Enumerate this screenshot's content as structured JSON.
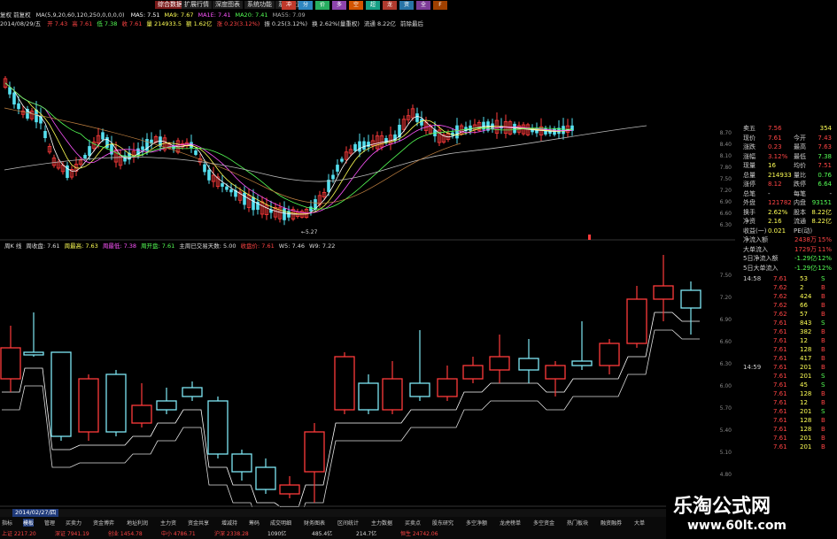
{
  "topbar": {
    "items": [
      {
        "label": "综合数据",
        "active": true
      },
      {
        "label": "扩展行情",
        "active": false
      },
      {
        "label": "深度图表",
        "active": false
      },
      {
        "label": "系统功能",
        "active": false
      },
      {
        "label": "系统设置",
        "active": false
      }
    ],
    "color_boxes": [
      {
        "label": "冲",
        "color": "#c0392b"
      },
      {
        "label": "分",
        "color": "#2e86c1"
      },
      {
        "label": "价",
        "color": "#27ae60"
      },
      {
        "label": "多",
        "color": "#8e44ad"
      },
      {
        "label": "空",
        "color": "#d35400"
      },
      {
        "label": "超",
        "color": "#16a085"
      },
      {
        "label": "龙",
        "color": "#b03a2e"
      },
      {
        "label": "资",
        "color": "#2874a6"
      },
      {
        "label": "全",
        "color": "#7d3c98"
      },
      {
        "label": "F",
        "color": "#a04000"
      }
    ]
  },
  "ma_line": {
    "name": "复权 前复权",
    "params": "MA(5,9,20,60,120,250,0,0,0,0)",
    "items": [
      {
        "label": "MA5: 7.51",
        "color": "#ffffff"
      },
      {
        "label": "MA9: 7.67",
        "color": "#ffff55"
      },
      {
        "label": "MA1E: 7.41",
        "color": "#ff55ff"
      },
      {
        "label": "MA20: 7.41",
        "color": "#55ff55"
      },
      {
        "label": "MA55: 7.09",
        "color": "#aaaaaa"
      }
    ]
  },
  "info_line": {
    "date": "2014/08/29/五",
    "items": [
      {
        "label": "开 7.43",
        "color": "#ff4444"
      },
      {
        "label": "高 7.61",
        "color": "#ff4444"
      },
      {
        "label": "低 7.38",
        "color": "#55ff55"
      },
      {
        "label": "收 7.61",
        "color": "#ff4444"
      },
      {
        "label": "量 214933.5",
        "color": "#ffff55"
      },
      {
        "label": "额 1.62亿",
        "color": "#ffff55"
      },
      {
        "label": "涨 0.23(3.12%)",
        "color": "#ff4444"
      },
      {
        "label": "振 0.25(3.12%)",
        "color": "#dddddd"
      },
      {
        "label": "换 2.62%(量重权)",
        "color": "#dddddd"
      },
      {
        "label": "流通 8.22亿",
        "color": "#dddddd"
      },
      {
        "label": "前除最后",
        "color": "#dddddd"
      }
    ]
  },
  "main_axis": {
    "labels": [
      "8.70",
      "8.40",
      "8.10",
      "7.80",
      "7.50",
      "7.20",
      "6.90",
      "6.60",
      "6.30"
    ]
  },
  "main_annotation": "←5.27",
  "lower_legend": {
    "items": [
      {
        "label": "周K 线",
        "color": "#dddddd"
      },
      {
        "label": "周收盘: 7.61",
        "color": "#dddddd"
      },
      {
        "label": "周最高: 7.63",
        "color": "#ffff55"
      },
      {
        "label": "周最低: 7.38",
        "color": "#ff55ff"
      },
      {
        "label": "周开盘: 7.61",
        "color": "#55ff55"
      },
      {
        "label": "主周已交易天数: 5.00",
        "color": "#dddddd"
      },
      {
        "label": "收盘价: 7.61",
        "color": "#ff4444"
      },
      {
        "label": "W5: 7.46",
        "color": "#dddddd"
      },
      {
        "label": "W9: 7.22",
        "color": "#dddddd"
      }
    ]
  },
  "lower_axis": {
    "labels": [
      "7.50",
      "7.20",
      "6.90",
      "6.60",
      "6.30",
      "6.00",
      "5.70",
      "5.40",
      "5.10",
      "4.80",
      "4.50"
    ]
  },
  "quote_panel": {
    "rows": [
      {
        "label": "卖五",
        "value": "7.56",
        "value_color": "#ff4444",
        "extra": "354",
        "extra_color": "#ffff55"
      },
      {
        "label": "现价",
        "value": "7.61",
        "value_color": "#ff4444",
        "label2": "今开",
        "value2": "7.43",
        "value2_color": "#ff4444"
      },
      {
        "label": "涨跌",
        "value": "0.23",
        "value_color": "#ff4444",
        "label2": "最高",
        "value2": "7.63",
        "value2_color": "#ff4444"
      },
      {
        "label": "涨幅",
        "value": "3.12%",
        "value_color": "#ff4444",
        "label2": "最低",
        "value2": "7.38",
        "value2_color": "#55ff55"
      },
      {
        "label": "现量",
        "value": "16",
        "value_color": "#ffff55",
        "label2": "均价",
        "value2": "7.51",
        "value2_color": "#ff4444"
      },
      {
        "label": "总量",
        "value": "214933",
        "value_color": "#ffff55",
        "label2": "量比",
        "value2": "0.76",
        "value2_color": "#55ff55"
      },
      {
        "label": "涨停",
        "value": "8.12",
        "value_color": "#ff4444",
        "label2": "跌停",
        "value2": "6.64",
        "value2_color": "#55ff55"
      },
      {
        "label": "总笔",
        "value": "-",
        "value_color": "#dddddd",
        "label2": "每笔",
        "value2": "-",
        "value2_color": "#dddddd"
      },
      {
        "label": "外盘",
        "value": "121782",
        "value_color": "#ff4444",
        "label2": "内盘",
        "value2": "93151",
        "value2_color": "#55ff55"
      },
      {
        "label": "换手",
        "value": "2.62%",
        "value_color": "#ffff55",
        "label2": "股本",
        "value2": "8.22亿",
        "value2_color": "#ffff55"
      },
      {
        "label": "净资",
        "value": "2.16",
        "value_color": "#ffff55",
        "label2": "流通",
        "value2": "8.22亿",
        "value2_color": "#ffff55"
      },
      {
        "label": "收益(一)",
        "value": "0.021",
        "value_color": "#ffff55",
        "label2": "PE(动)",
        "value2": "",
        "value2_color": "#ffff55"
      }
    ],
    "flow_rows": [
      {
        "label": "净流入额",
        "value": "2438万",
        "pct": "15%"
      },
      {
        "label": "大单流入",
        "value": "1729万",
        "pct": "11%"
      },
      {
        "label": "5日净流入额",
        "value": "-1.29亿",
        "pct": "-12%"
      },
      {
        "label": "5日大单流入",
        "value": "-1.29亿",
        "pct": "-12%"
      }
    ],
    "ticks": [
      {
        "time": "14:58",
        "price": "7.61",
        "vol": "53",
        "side": "S"
      },
      {
        "time": "",
        "price": "7.62",
        "vol": "2",
        "side": "B"
      },
      {
        "time": "",
        "price": "7.62",
        "vol": "424",
        "side": "B"
      },
      {
        "time": "",
        "price": "7.62",
        "vol": "66",
        "side": "B"
      },
      {
        "time": "",
        "price": "7.62",
        "vol": "57",
        "side": "B"
      },
      {
        "time": "",
        "price": "7.61",
        "vol": "843",
        "side": "S"
      },
      {
        "time": "",
        "price": "7.61",
        "vol": "382",
        "side": "B"
      },
      {
        "time": "",
        "price": "7.61",
        "vol": "12",
        "side": "B"
      },
      {
        "time": "",
        "price": "7.61",
        "vol": "128",
        "side": "B"
      },
      {
        "time": "",
        "price": "7.61",
        "vol": "417",
        "side": "B"
      },
      {
        "time": "14:59",
        "price": "7.61",
        "vol": "201",
        "side": "B"
      },
      {
        "time": "",
        "price": "7.61",
        "vol": "201",
        "side": "S"
      },
      {
        "time": "",
        "price": "7.61",
        "vol": "45",
        "side": "S"
      },
      {
        "time": "",
        "price": "7.61",
        "vol": "128",
        "side": "B"
      },
      {
        "time": "",
        "price": "7.61",
        "vol": "12",
        "side": "B"
      },
      {
        "time": "",
        "price": "7.61",
        "vol": "201",
        "side": "S"
      },
      {
        "time": "",
        "price": "7.61",
        "vol": "128",
        "side": "B"
      },
      {
        "time": "",
        "price": "7.61",
        "vol": "128",
        "side": "B"
      },
      {
        "time": "",
        "price": "7.61",
        "vol": "201",
        "side": "B"
      },
      {
        "time": "",
        "price": "7.61",
        "vol": "201",
        "side": "B"
      }
    ]
  },
  "bottom": {
    "date_tab": "2014/02/27/四",
    "nav": [
      "指标",
      "模板",
      "管理",
      "买卖力",
      "资金博弈",
      "地址利润",
      "主力资",
      "资金共享",
      "增减持",
      "筹码",
      "成交明细",
      "财务图表",
      "区间统计",
      "主力数据",
      "买卖点",
      "股东研究",
      "多空净额",
      "龙虎榜单",
      "多空资金",
      "热门板块",
      "融资融券",
      "大单"
    ],
    "ticker": [
      {
        "label": "上证 2217.20",
        "color": "#ff4444"
      },
      {
        "label": "深证 7941.19",
        "color": "#ff4444"
      },
      {
        "label": "创业 1454.78",
        "color": "#ff4444"
      },
      {
        "label": "中小 4786.71",
        "color": "#ff4444"
      },
      {
        "label": "沪深 2338.28",
        "color": "#ff4444"
      },
      {
        "label": "1090亿",
        "color": "#dddddd"
      },
      {
        "label": "485.4亿",
        "color": "#dddddd"
      },
      {
        "label": "214.7亿",
        "color": "#dddddd"
      },
      {
        "label": "恒生 24742.06",
        "color": "#ff4444"
      }
    ]
  },
  "watermark": {
    "title": "乐淘公式网",
    "url": "www.60lt.com"
  }
}
